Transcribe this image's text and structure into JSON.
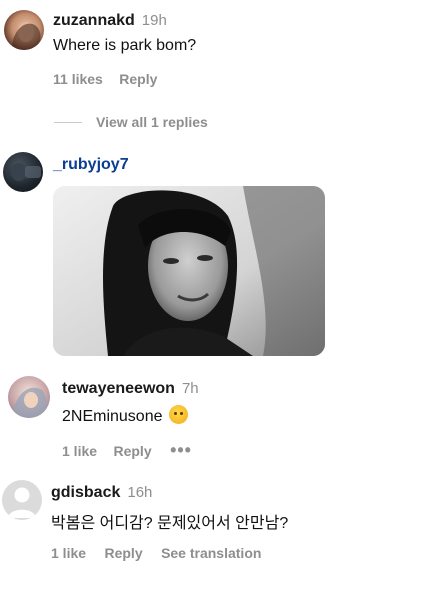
{
  "comments": [
    {
      "username": "zuzannakd",
      "time": "19h",
      "text": "Where is park bom?",
      "likes": "11 likes",
      "reply": "Reply",
      "view_replies": "View all 1 replies"
    },
    {
      "username": "_rubyjoy7"
    },
    {
      "username": "tewayeneewon",
      "time": "7h",
      "text": "2NEminusone",
      "emoji": "hugging-face-emoji",
      "likes": "1 like",
      "reply": "Reply",
      "more": "•••"
    },
    {
      "username": "gdisback",
      "time": "16h",
      "text": "박봄은 어디감? 문제있어서 안만남?",
      "likes": "1 like",
      "reply": "Reply",
      "see_translation": "See translation"
    }
  ],
  "icons": {
    "default_avatar": "default-avatar-icon",
    "more": "more-options-icon"
  },
  "colors": {
    "username": "#1a1a1a",
    "muted": "#8e8e8e",
    "rubyjoy_username": "#0b3d91"
  }
}
